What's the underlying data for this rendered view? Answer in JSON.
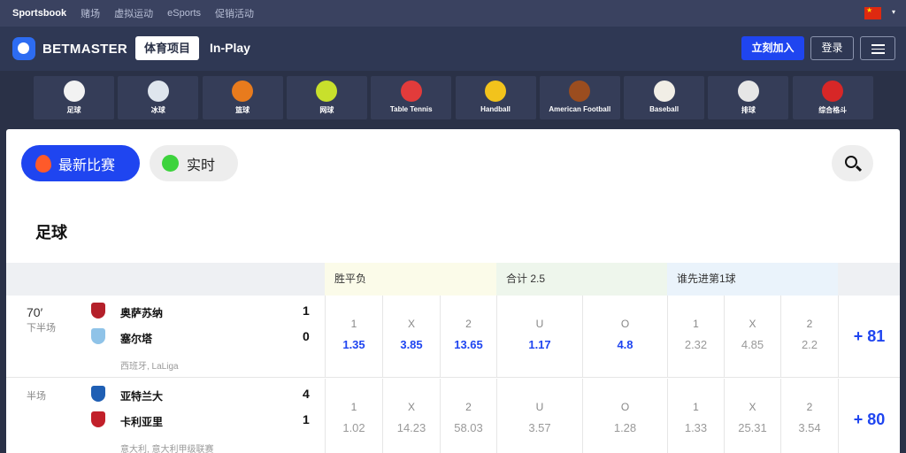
{
  "topbar": {
    "items": [
      "Sportsbook",
      "赌场",
      "虚拟运动",
      "eSports",
      "促销活动"
    ]
  },
  "header": {
    "logo": "BETMASTER",
    "nav_sports": "体育项目",
    "nav_inplay": "In-Play",
    "join": "立刻加入",
    "login": "登录"
  },
  "sports": [
    {
      "label": "足球",
      "color": "#f2f2f2"
    },
    {
      "label": "冰球",
      "color": "#dfe6ee"
    },
    {
      "label": "篮球",
      "color": "#e87b1d"
    },
    {
      "label": "网球",
      "color": "#c8e02c"
    },
    {
      "label": "Table Tennis",
      "color": "#e23b3b"
    },
    {
      "label": "Handball",
      "color": "#f2c31c"
    },
    {
      "label": "American Football",
      "color": "#9b4d1f"
    },
    {
      "label": "Baseball",
      "color": "#f1eee6"
    },
    {
      "label": "排球",
      "color": "#e6e6e6"
    },
    {
      "label": "综合格斗",
      "color": "#d72727"
    }
  ],
  "filters": {
    "latest": "最新比赛",
    "live": "实时"
  },
  "section_title": "足球",
  "markets": [
    {
      "label": "胜平负",
      "bg": "#fbfbe9"
    },
    {
      "label": "合计 2.5",
      "bg": "#eef6ec"
    },
    {
      "label": "谁先进第1球",
      "bg": "#eaf3fb"
    }
  ],
  "matches": [
    {
      "time": "70′",
      "period": "下半场",
      "home": "奥萨苏纳",
      "away": "塞尔塔",
      "home_score": "1",
      "away_score": "0",
      "league": "西班牙, LaLiga",
      "odds": [
        {
          "label": "1",
          "value": "1.35"
        },
        {
          "label": "X",
          "value": "3.85"
        },
        {
          "label": "2",
          "value": "13.65"
        },
        {
          "label": "U",
          "value": "1.17"
        },
        {
          "label": "O",
          "value": "4.8"
        },
        {
          "label": "1",
          "value": "2.32"
        },
        {
          "label": "X",
          "value": "4.85"
        },
        {
          "label": "2",
          "value": "2.2"
        }
      ],
      "more": "+ 81"
    },
    {
      "time": "",
      "period": "半场",
      "home": "亚特兰大",
      "away": "卡利亚里",
      "home_score": "4",
      "away_score": "1",
      "league": "意大利, 意大利甲级联赛",
      "odds": [
        {
          "label": "1",
          "value": "1.02"
        },
        {
          "label": "X",
          "value": "14.23"
        },
        {
          "label": "2",
          "value": "58.03"
        },
        {
          "label": "U",
          "value": "3.57"
        },
        {
          "label": "O",
          "value": "1.28"
        },
        {
          "label": "1",
          "value": "1.33"
        },
        {
          "label": "X",
          "value": "25.31"
        },
        {
          "label": "2",
          "value": "3.54"
        }
      ],
      "more": "+ 80"
    }
  ]
}
